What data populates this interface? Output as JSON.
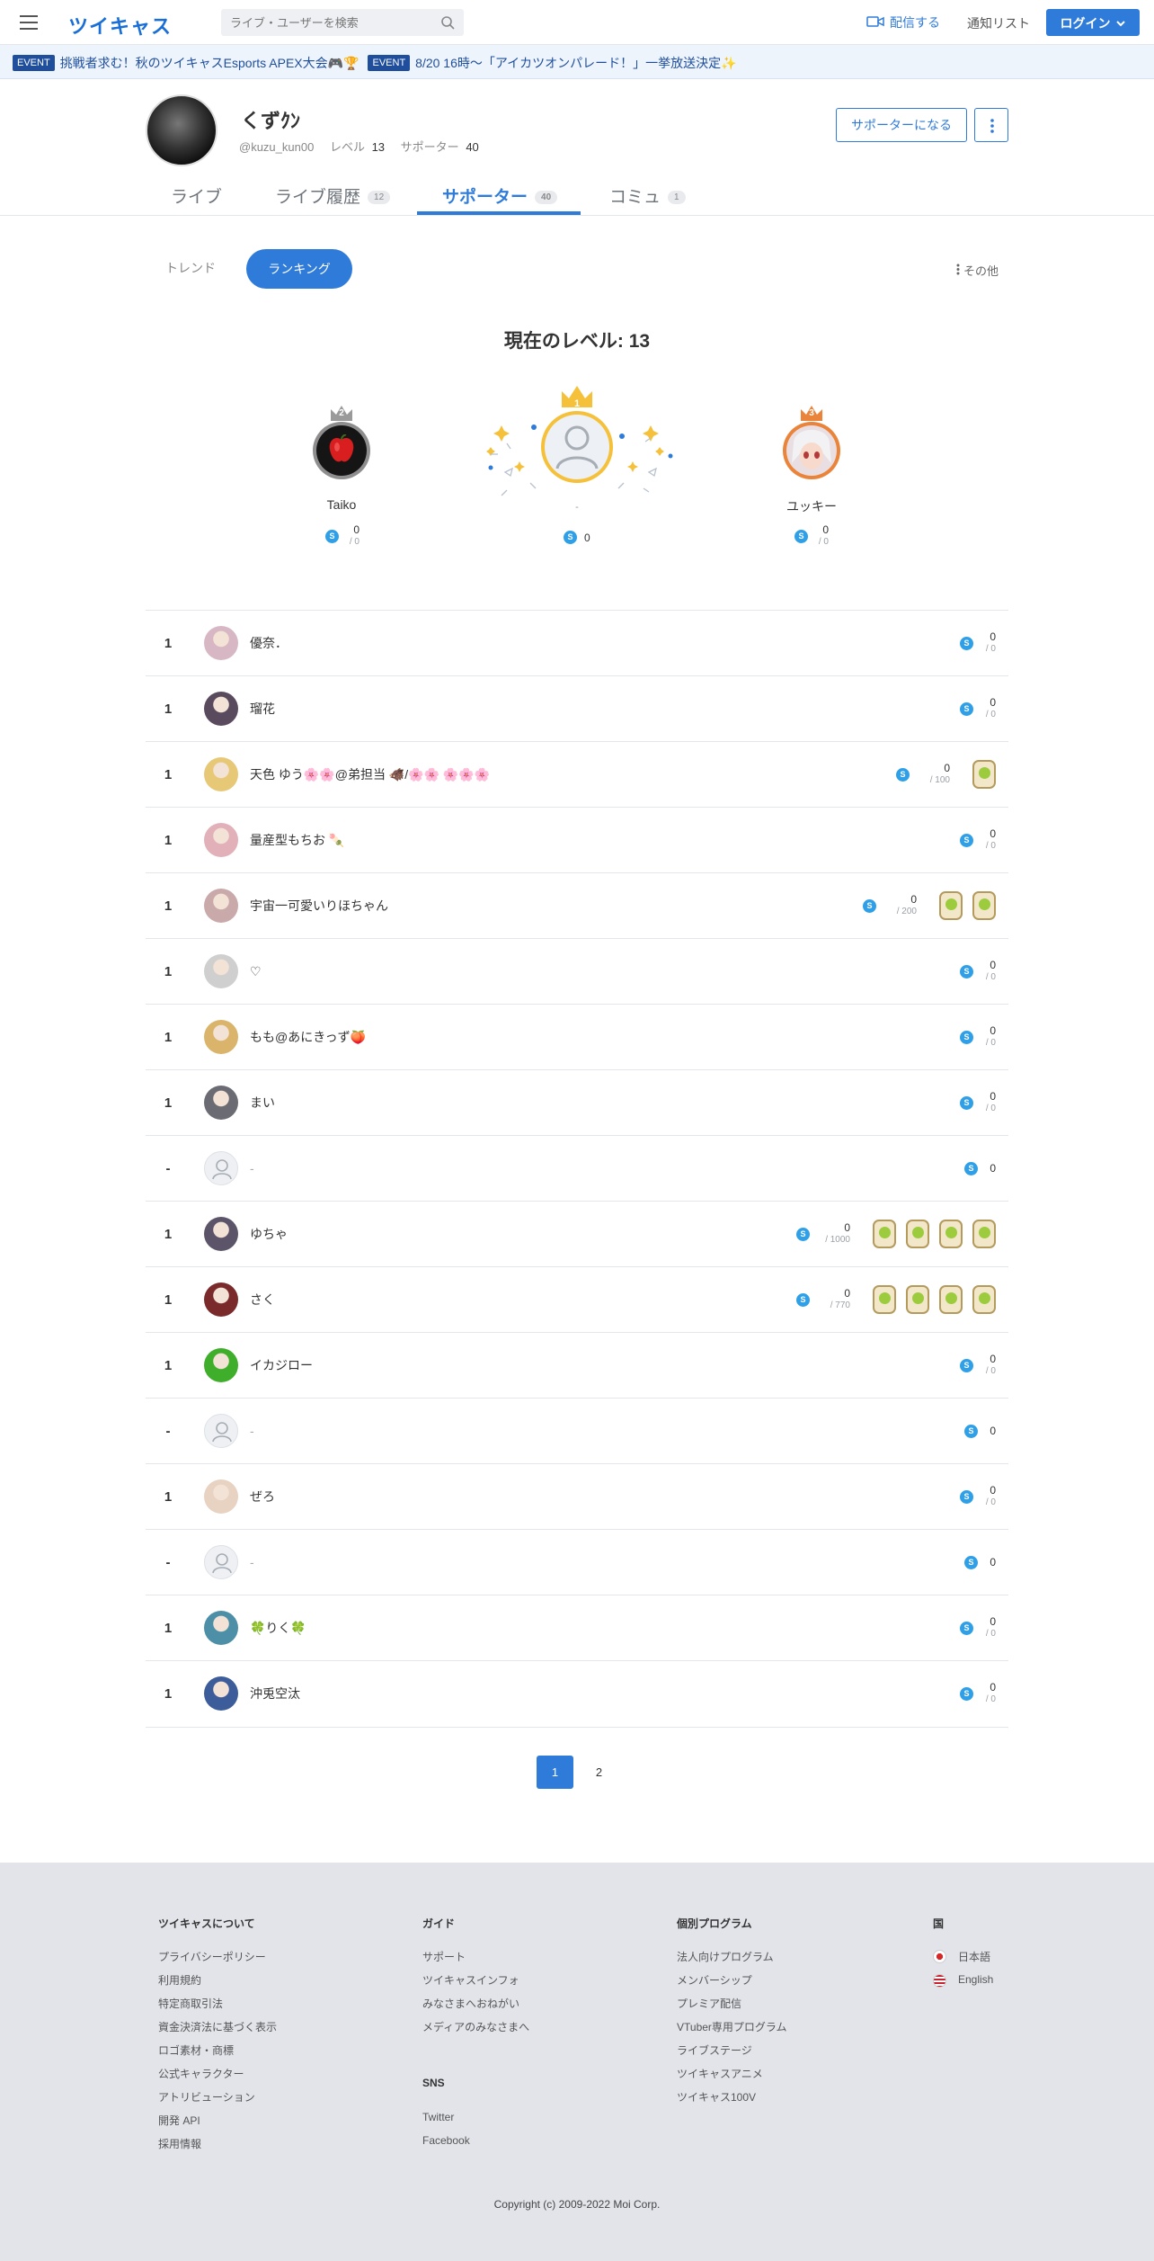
{
  "header": {
    "logo": "ツイキャス",
    "search_placeholder": "ライブ・ユーザーを検索",
    "broadcast_label": "配信する",
    "notification_label": "通知リスト",
    "login_label": "ログイン"
  },
  "ticker": [
    {
      "badge": "EVENT",
      "text": "挑戦者求む！秋のツイキャスEsports APEX大会🎮🏆"
    },
    {
      "badge": "EVENT",
      "text": "8/20 16時〜「アイカツオンパレード！」一挙放送決定✨"
    }
  ],
  "profile": {
    "name": "くずｸﾝ",
    "handle": "@kuzu_kun00",
    "level_label": "レベル",
    "level_value": "13",
    "supporter_label": "サポーター",
    "supporter_value": "40",
    "become_supporter_label": "サポーターになる"
  },
  "tabs": [
    {
      "label": "ライブ",
      "count": ""
    },
    {
      "label": "ライブ履歴",
      "count": "12"
    },
    {
      "label": "サポーター",
      "count": "40"
    },
    {
      "label": "コミュ",
      "count": "1"
    }
  ],
  "filters": {
    "trend": "トレンド",
    "ranking": "ランキング",
    "other": "その他"
  },
  "current_level": "現在のレベル: 13",
  "podium": [
    {
      "place": "2",
      "name": "Taiko",
      "points": "0",
      "max": "/ 0"
    },
    {
      "place": "1",
      "name": "-",
      "points": "0",
      "max": ""
    },
    {
      "place": "3",
      "name": "ユッキー",
      "points": "0",
      "max": "/ 0"
    }
  ],
  "ranking": [
    {
      "rank": "1",
      "name": "優奈．",
      "points": "0",
      "max": "/ 0",
      "badges": 0,
      "avatar_color": "#d8b7c4"
    },
    {
      "rank": "1",
      "name": "瑠花",
      "points": "0",
      "max": "/ 0",
      "badges": 0,
      "avatar_color": "#5a4a5e"
    },
    {
      "rank": "1",
      "name": "天色 ゆう🌸🌸@弟担当 🐗/🌸🌸 🌸🌸🌸",
      "points": "0",
      "max": "/ 100",
      "badges": 1,
      "avatar_color": "#e7c877"
    },
    {
      "rank": "1",
      "name": "量産型もちお 🍡",
      "points": "0",
      "max": "/ 0",
      "badges": 0,
      "avatar_color": "#e2b0b8"
    },
    {
      "rank": "1",
      "name": "宇宙一可愛いりほちゃん",
      "points": "0",
      "max": "/ 200",
      "badges": 2,
      "avatar_color": "#c9a9a9"
    },
    {
      "rank": "1",
      "name": "♡",
      "points": "0",
      "max": "/ 0",
      "badges": 0,
      "avatar_color": "#cfcfcf"
    },
    {
      "rank": "1",
      "name": "もも@あにきっず🍑",
      "points": "0",
      "max": "/ 0",
      "badges": 0,
      "avatar_color": "#d9b46a"
    },
    {
      "rank": "1",
      "name": "まい",
      "points": "0",
      "max": "/ 0",
      "badges": 0,
      "avatar_color": "#6b6b74"
    },
    {
      "rank": "-",
      "name": "-",
      "points": "0",
      "max": "",
      "badges": 0,
      "avatar_color": ""
    },
    {
      "rank": "1",
      "name": "ゆちゃ",
      "points": "0",
      "max": "/ 1000",
      "badges": 4,
      "avatar_color": "#5c5468"
    },
    {
      "rank": "1",
      "name": "さく",
      "points": "0",
      "max": "/ 770",
      "badges": 4,
      "avatar_color": "#7a2a2a"
    },
    {
      "rank": "1",
      "name": "イカジロー",
      "points": "0",
      "max": "/ 0",
      "badges": 0,
      "avatar_color": "#3fae2a"
    },
    {
      "rank": "-",
      "name": "-",
      "points": "0",
      "max": "",
      "badges": 0,
      "avatar_color": ""
    },
    {
      "rank": "1",
      "name": "ぜろ",
      "points": "0",
      "max": "/ 0",
      "badges": 0,
      "avatar_color": "#e8d2c1"
    },
    {
      "rank": "-",
      "name": "-",
      "points": "0",
      "max": "",
      "badges": 0,
      "avatar_color": ""
    },
    {
      "rank": "1",
      "name": "🍀りく🍀",
      "points": "0",
      "max": "/ 0",
      "badges": 0,
      "avatar_color": "#4c8fa6"
    },
    {
      "rank": "1",
      "name": "沖兎空汰",
      "points": "0",
      "max": "/ 0",
      "badges": 0,
      "avatar_color": "#3d5c9a"
    }
  ],
  "pagination": [
    "1",
    "2"
  ],
  "footer": {
    "columns": [
      {
        "title": "ツイキャスについて",
        "links": [
          "プライバシーポリシー",
          "利用規約",
          "特定商取引法",
          "資金決済法に基づく表示",
          "ロゴ素材・商標",
          "公式キャラクター",
          "アトリビューション",
          "開発 API",
          "採用情報"
        ]
      },
      {
        "title": "ガイド",
        "links": [
          "サポート",
          "ツイキャスインフォ",
          "みなさまへおねがい",
          "メディアのみなさまへ"
        ]
      },
      {
        "title": "個別プログラム",
        "links": [
          "法人向けプログラム",
          "メンバーシップ",
          "プレミア配信",
          "VTuber専用プログラム",
          "ライブステージ",
          "ツイキャスアニメ",
          "ツイキャス100V"
        ]
      },
      {
        "title": "国",
        "links": [
          "日本語",
          "English"
        ]
      }
    ],
    "sns_title": "SNS",
    "sns_links": [
      "Twitter",
      "Facebook"
    ],
    "copyright": "Copyright (c) 2009-2022 Moi Corp."
  },
  "colors": {
    "accent": "#2f7bd9",
    "coin": "#2fa0e8",
    "gold": "#f5c03a",
    "silver": "#9a9a9a",
    "bronze": "#e9843a"
  }
}
